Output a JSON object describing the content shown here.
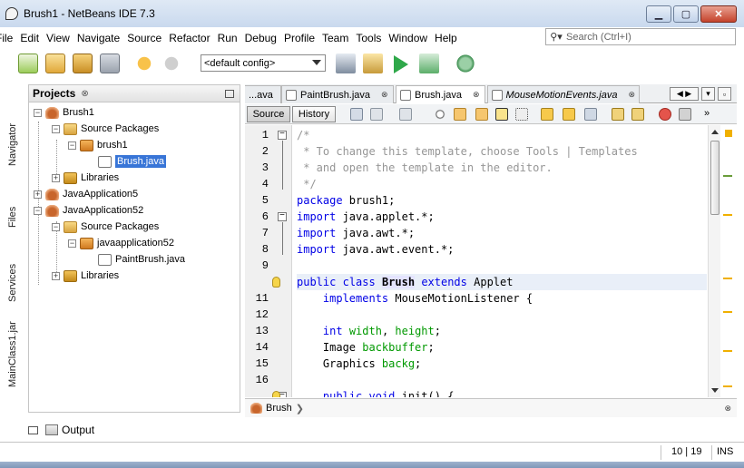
{
  "window": {
    "title": "Brush1 - NetBeans IDE 7.3",
    "minimize": "▁",
    "maximize": "▢",
    "close": "✕"
  },
  "menu": [
    "File",
    "Edit",
    "View",
    "Navigate",
    "Source",
    "Refactor",
    "Run",
    "Debug",
    "Profile",
    "Team",
    "Tools",
    "Window",
    "Help"
  ],
  "search": {
    "placeholder": "Search (Ctrl+I)"
  },
  "toolbar": {
    "config": "<default config>"
  },
  "side_tabs": {
    "navigator": "Navigator",
    "files": "Files",
    "services": "Services",
    "mainclass": "MainClass1.jar"
  },
  "projects": {
    "title": "Projects",
    "close": "⊗",
    "nodes": [
      {
        "label": "Brush1"
      },
      {
        "label": "Source Packages"
      },
      {
        "label": "brush1"
      },
      {
        "label": "Brush.java"
      },
      {
        "label": "Libraries"
      },
      {
        "label": "JavaApplication5"
      },
      {
        "label": "JavaApplication52"
      },
      {
        "label": "Source Packages"
      },
      {
        "label": "javaapplication52"
      },
      {
        "label": "PaintBrush.java"
      },
      {
        "label": "Libraries"
      }
    ]
  },
  "editor": {
    "tabs": [
      {
        "label": "...ava",
        "close": "⊗"
      },
      {
        "label": "PaintBrush.java",
        "close": "⊗"
      },
      {
        "label": "Brush.java",
        "close": "⊗"
      },
      {
        "label": "MouseMotionEvents.java",
        "close": "⊗"
      }
    ],
    "source_btn": "Source",
    "history_btn": "History",
    "more_btn": "»",
    "code_lines": [
      "/*",
      " * To change this template, choose Tools | Templates",
      " * and open the template in the editor.",
      " */",
      "package brush1;",
      "import java.applet.*;",
      "import java.awt.*;",
      "import java.awt.event.*;",
      "",
      "public class Brush extends Applet",
      "    implements MouseMotionListener {",
      "",
      "    int width, height;",
      "    Image backbuffer;",
      "    Graphics backg;",
      "",
      "    public void init() {"
    ],
    "line_numbers": [
      "1",
      "2",
      "3",
      "4",
      "5",
      "6",
      "7",
      "8",
      "9",
      "",
      "11",
      "12",
      "13",
      "14",
      "15",
      "16",
      ""
    ],
    "breadcrumb": "Brush",
    "breadcrumb_close": "⊗"
  },
  "output": {
    "label": "Output"
  },
  "status": {
    "position": "10 | 19",
    "mode": "INS"
  },
  "colors": {
    "keyword": "#0000e6",
    "comment": "#969696",
    "field": "#009900",
    "selection": "#3875d7"
  }
}
